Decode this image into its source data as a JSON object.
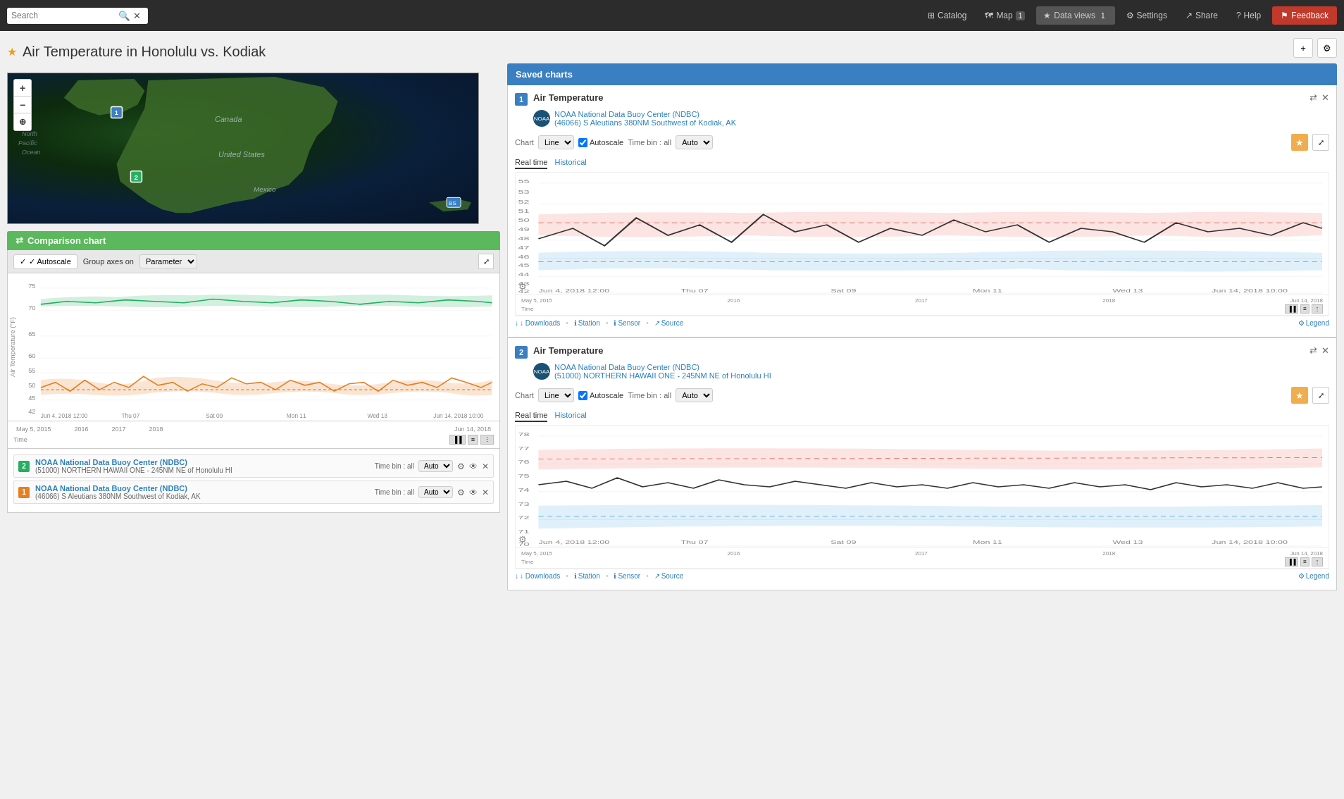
{
  "navbar": {
    "search_placeholder": "Search",
    "catalog": "Catalog",
    "map": "Map",
    "map_badge": "1",
    "data_views": "Data views",
    "data_views_badge": "1",
    "settings": "Settings",
    "share": "Share",
    "help": "Help",
    "feedback": "Feedback"
  },
  "page": {
    "title": "Air Temperature in Honolulu vs. Kodiak",
    "star": "★"
  },
  "map": {
    "zoom_in": "+",
    "zoom_out": "−",
    "zoom_fit": "⊕",
    "label_pacific": "North Pacific Ocean",
    "label_canada": "Canada",
    "label_us": "United States",
    "label_mexico": "Mexico",
    "marker1_label": "1",
    "marker2_label": "2",
    "marker_bs": "BS"
  },
  "comparison": {
    "title": "Comparison chart",
    "autoscale_label": "✓ Autoscale",
    "group_axes_label": "Group axes on",
    "group_axes_value": "Parameter",
    "expand_icon": "⤢"
  },
  "legend_items": [
    {
      "color": "#27ae60",
      "number": "2",
      "title": "NOAA National Data Buoy Center (NDBC)",
      "subtitle": "(51000) NORTHERN HAWAII ONE - 245NM NE of Honolulu HI",
      "timebin": "Time bin : all",
      "auto": "Auto"
    },
    {
      "color": "#e67e22",
      "number": "1",
      "title": "NOAA National Data Buoy Center (NDBC)",
      "subtitle": "(46066) S Aleutians 380NM Southwest of Kodiak, AK",
      "timebin": "Time bin : all",
      "auto": "Auto"
    }
  ],
  "saved_charts_header": "Saved charts",
  "charts": [
    {
      "number": "1",
      "title": "Air Temperature",
      "station_org": "NOAA National Data Buoy Center (NDBC)",
      "station_name": "(46066) S Aleutians 380NM Southwest of Kodiak, AK",
      "chart_label": "Chart",
      "chart_type": "Line",
      "autoscale": "Autoscale",
      "timebin_label": "Time bin : all",
      "timebin_value": "Auto",
      "tab_realtime": "Real time",
      "tab_historical": "Historical",
      "y_min": 42,
      "y_max": 55,
      "x_labels": [
        "Jun 4, 2018 12:00",
        "Thu 07",
        "Sat 09",
        "Mon 11",
        "Wed 13",
        "Jun 14, 2018 10:00"
      ],
      "footer_downloads": "↓ Downloads",
      "footer_station": "Station",
      "footer_sensor": "Sensor",
      "footer_source": "Source",
      "footer_legend": "Legend",
      "time_range_start": "May 5, 2015",
      "time_range_2016": "2016",
      "time_range_2017": "2017",
      "time_range_2018": "2018",
      "time_range_end": "Jun 14, 2018"
    },
    {
      "number": "2",
      "title": "Air Temperature",
      "station_org": "NOAA National Data Buoy Center (NDBC)",
      "station_name": "(51000) NORTHERN HAWAII ONE - 245NM NE of Honolulu HI",
      "chart_label": "Chart",
      "chart_type": "Line",
      "autoscale": "Autoscale",
      "timebin_label": "Time bin : all",
      "timebin_value": "Auto",
      "tab_realtime": "Real time",
      "tab_historical": "Historical",
      "y_min": 70,
      "y_max": 78,
      "x_labels": [
        "Jun 4, 2018 12:00",
        "Thu 07",
        "Sat 09",
        "Mon 11",
        "Wed 13",
        "Jun 14, 2018 10:00"
      ],
      "footer_downloads": "↓ Downloads",
      "footer_station": "Station",
      "footer_sensor": "Sensor",
      "footer_source": "Source",
      "footer_legend": "Legend",
      "time_range_start": "May 5, 2015",
      "time_range_2016": "2016",
      "time_range_2017": "2017",
      "time_range_2018": "2018",
      "time_range_end": "Jun 14, 2018"
    }
  ],
  "icons": {
    "shuffle": "⇄",
    "close": "✕",
    "star": "★",
    "gear": "⚙",
    "eye": "👁",
    "fullscreen": "⛶",
    "download": "↓",
    "info": "ℹ",
    "refresh": "↺",
    "plus": "+",
    "flag": "⚑"
  }
}
